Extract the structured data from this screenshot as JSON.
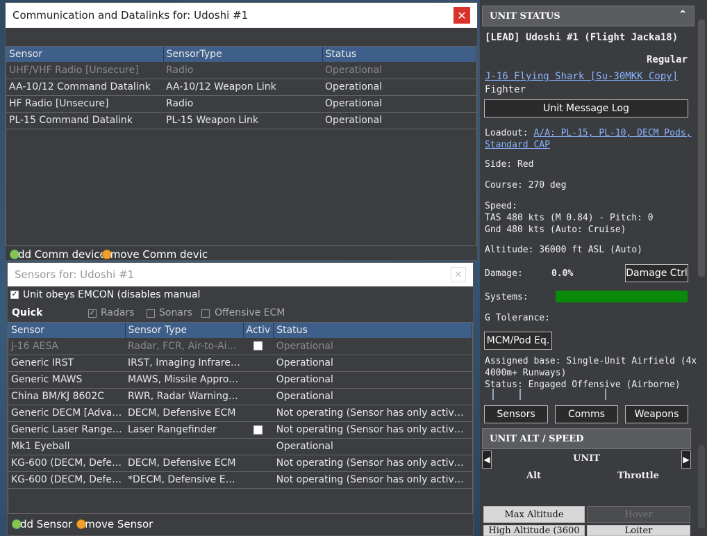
{
  "comm_window": {
    "title": "Communication and Datalinks for: Udoshi #1",
    "columns": [
      "Sensor",
      "SensorType",
      "Status"
    ],
    "rows": [
      {
        "sensor": "UHF/VHF Radio [Unsecure]",
        "type": "Radio",
        "status": "Operational",
        "dim": true
      },
      {
        "sensor": "AA-10/12 Command Datalink",
        "type": "AA-10/12 Weapon Link",
        "status": "Operational",
        "dim": false
      },
      {
        "sensor": "HF Radio [Unsecure]",
        "type": "Radio",
        "status": "Operational",
        "dim": false
      },
      {
        "sensor": "PL-15 Command Datalink",
        "type": "PL-15 Weapon Link",
        "status": "Operational",
        "dim": false
      }
    ],
    "add_label": "dd Comm device",
    "remove_label": "move Comm devic"
  },
  "sensor_window": {
    "title": "Sensors for: Udoshi #1",
    "emcon_label": "Unit obeys EMCON (disables manual",
    "quick_label": "Quick",
    "quick_radars": "Radars",
    "quick_sonars": "Sonars",
    "quick_ecm": "Offensive ECM",
    "columns": [
      "Sensor",
      "Sensor Type",
      "Activ",
      "Status"
    ],
    "rows": [
      {
        "sensor": "J-16 AESA",
        "type": "Radar, FCR, Air-to-Air ...",
        "active": true,
        "status": "Operational",
        "dim": true
      },
      {
        "sensor": "Generic IRST",
        "type": "IRST, Imaging Infrared...",
        "active": false,
        "status": "Operational",
        "dim": false
      },
      {
        "sensor": "Generic MAWS",
        "type": "MAWS, Missile Approa...",
        "active": false,
        "status": "Operational",
        "dim": false
      },
      {
        "sensor": "China BM/KJ 8602C",
        "type": "RWR, Radar Warning R...",
        "active": false,
        "status": "Operational",
        "dim": false
      },
      {
        "sensor": "Generic DECM [Advan...",
        "type": "DECM, Defensive ECM",
        "active": false,
        "status": "Not operating (Sensor has only active mo...",
        "dim": false
      },
      {
        "sensor": "Generic Laser Rangefi...",
        "type": "Laser Rangefinder",
        "active": true,
        "status": "Not operating (Sensor has only active mo...",
        "dim": false
      },
      {
        "sensor": "Mk1 Eyeball",
        "type": "",
        "active": false,
        "status": "Operational",
        "dim": false
      },
      {
        "sensor": "KG-600 (DECM, Defen...",
        "type": "DECM, Defensive ECM",
        "active": false,
        "status": "Not operating (Sensor has only active mo...",
        "dim": false
      },
      {
        "sensor": "KG-600 (DECM, Defen...",
        "type": "*DECM, Defensive ECM",
        "active": false,
        "status": "Not operating (Sensor has only active mo...",
        "dim": false
      }
    ],
    "add_label": "dd Sensor",
    "remove_label": "move Sensor"
  },
  "unit_status": {
    "header": "UNIT STATUS",
    "unit_name": "[LEAD] Udoshi #1 (Flight Jacka18)",
    "proficiency": "Regular",
    "aircraft_link": "J-16 Flying Shark [Su-30MKK Copy]",
    "role": "Fighter",
    "message_log_btn": "Unit Message Log",
    "loadout_label": "Loadout:",
    "loadout_link_1": "A/A: PL-15, PL-10, DECM Pods,",
    "loadout_link_2": "Standard CAP",
    "side": "Side: Red",
    "course": "Course: 270 deg",
    "speed_label": "Speed:",
    "speed_tas": "TAS 480 kts (M 0.84) - Pitch: 0",
    "speed_gnd": "Gnd 480 kts (Auto: Cruise)",
    "altitude": "Altitude: 36000 ft ASL (Auto)",
    "damage_label": "Damage:",
    "damage_value": "0.0%",
    "damage_btn": "Damage Ctrl",
    "systems_label": "Systems:",
    "systems_level": 1.0,
    "g_tolerance": "G Tolerance:",
    "mcm_btn": "MCM/Pod Eq.",
    "assigned_base_1": "Assigned base: Single-Unit Airfield (4x",
    "assigned_base_2": "4000m+ Runways)",
    "status_line": "Status: Engaged Offensive (Airborne)",
    "sensors_btn": "Sensors",
    "comms_btn": "Comms",
    "weapons_btn": "Weapons"
  },
  "alt_speed": {
    "header": "UNIT ALT / SPEED",
    "unit_label": "UNIT",
    "alt_label": "Alt",
    "throttle_label": "Throttle",
    "max_alt_btn": "Max Altitude",
    "hover_btn": "Hover",
    "high_alt_btn": "High Altitude (3600",
    "loiter_btn": "Loiter"
  },
  "colors": {
    "header_blue": "#3e5f8a",
    "systems_green": "#0a8a0a",
    "close_red": "#d9312b"
  }
}
